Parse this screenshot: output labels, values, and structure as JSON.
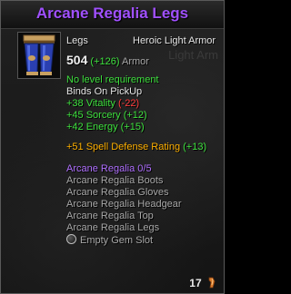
{
  "item": {
    "name": "Arcane Regalia Legs",
    "slot": "Legs",
    "type": "Heroic Light Armor",
    "watermark": "Light Arm",
    "armor": {
      "value": "504",
      "bonus": "(+126)",
      "label": "Armor"
    },
    "requirement": "No level requirement",
    "binding": "Binds On PickUp",
    "stats": [
      {
        "text": "+38 Vitality",
        "diff": "(-22)",
        "diff_color": "red"
      },
      {
        "text": "+45 Sorcery",
        "diff": "(+12)",
        "diff_color": "green"
      },
      {
        "text": "+42 Energy",
        "diff": "(+15)",
        "diff_color": "green"
      }
    ],
    "spell_defense": {
      "text": "+51 Spell Defense Rating",
      "diff": "(+13)"
    },
    "set": {
      "name": "Arcane Regalia 0/5",
      "pieces": [
        "Arcane Regalia Boots",
        "Arcane Regalia Gloves",
        "Arcane Regalia Headgear",
        "Arcane Regalia Top",
        "Arcane Regalia Legs"
      ]
    },
    "gem_slot": "Empty Gem Slot",
    "icon": "leg-armor-icon",
    "durability": "17",
    "durability_icon": "durability-icon"
  },
  "colors": {
    "title": "#a050ff",
    "green": "#3ee03e",
    "red": "#ff3a3a",
    "orange": "#ffb000",
    "set_name": "#b070ff",
    "set_piece": "#a8a8a8"
  }
}
